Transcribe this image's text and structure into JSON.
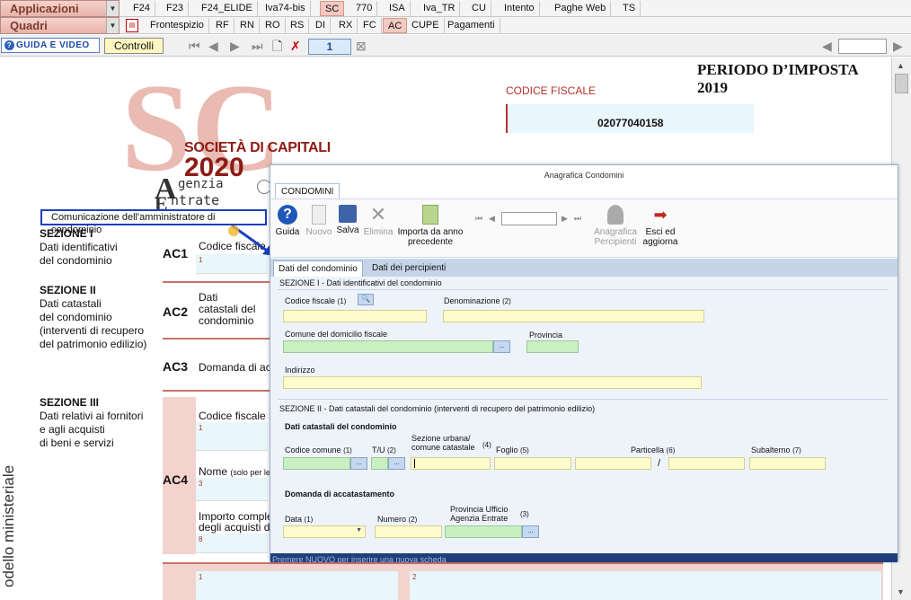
{
  "menu": {
    "applicazioni": "Applicazioni",
    "quadri": "Quadri"
  },
  "tabs_top": [
    "F24",
    "F23",
    "F24_ELIDE",
    "Iva74-bis",
    "SC",
    "770",
    "ISA",
    "Iva_TR",
    "CU",
    "Intento",
    "Paghe Web",
    "TS"
  ],
  "tabs_quadri": [
    "Frontespizio",
    "RF",
    "RN",
    "RO",
    "RS",
    "DI",
    "RX",
    "FC",
    "AC",
    "CUPE",
    "Pagamenti"
  ],
  "toolbar": {
    "guida": "GUIDA E VIDEO",
    "controlli": "Controlli",
    "page": "1"
  },
  "doc": {
    "periodo": "PERIODO D’IMPOSTA 2019",
    "codice_fiscale_label": "CODICE FISCALE",
    "codice_fiscale": "02077040158",
    "logo_line1": "SOCIETÀ DI CAPITALI",
    "logo_year": "2020",
    "logo_agenzia": "genzia",
    "logo_entrate": "ntrate",
    "tooltip": "Comunicazione dell'amministratore di condominio",
    "sez1_title": "SEZIONE I",
    "sez1_text": [
      "Dati identificativi",
      "del condominio"
    ],
    "sez2_title": "SEZIONE II",
    "sez2_text": [
      "Dati catastali",
      "del condominio",
      "(interventi di recupero",
      "del patrimonio edilizio)"
    ],
    "sez3_title": "SEZIONE III",
    "sez3_text": [
      "Dati relativi ai fornitori",
      "e agli acquisti",
      "di beni e servizi"
    ],
    "ac1": "AC1",
    "ac2": "AC2",
    "ac3": "AC3",
    "ac4": "AC4",
    "ac1_label": "Codice fiscale",
    "ac2_label": [
      "Dati",
      "catastali del",
      "condominio"
    ],
    "ac3_label": "Domanda di ac",
    "ac4_cf": "Codice fiscale",
    "ac4_nome": "Nome",
    "ac4_nome_note": "(solo per le",
    "ac4_importo": [
      "Importo comple",
      "degli acquisti di"
    ],
    "n1": "1",
    "n3": "3",
    "n8": "8",
    "n2": "2",
    "vertical": "odello ministeriale"
  },
  "dialog": {
    "title": "Anagrafica Condomini",
    "tab": "CONDOMINI",
    "buttons": {
      "guida": "Guida",
      "nuovo": "Nuovo",
      "salva": "Salva",
      "elimina": "Elimina",
      "importa": [
        "Importa da anno",
        "precedente"
      ],
      "anag": [
        "Anagrafica",
        "Percipienti"
      ],
      "esci": [
        "Esci ed",
        "aggiorna"
      ]
    },
    "subtabs": [
      "Dati del condominio",
      "Dati dei percipienti"
    ],
    "s1_title": "SEZIONE I - Dati identificativi del condominio",
    "cf": "Codice fiscale",
    "cf_n": "(1)",
    "den": "Denominazione",
    "den_n": "(2)",
    "comune": "Comune del domicilio fiscale",
    "provincia": "Provincia",
    "indirizzo": "Indirizzo",
    "s2_title": "SEZIONE II - Dati catastali del condominio (interventi di recupero del patrimonio edilizio)",
    "dati_cat": "Dati catastali del condominio",
    "cod_comune": "Codice comune",
    "cod_comune_n": "(1)",
    "tu": "T/U",
    "tu_n": "(2)",
    "sez_urb": [
      "Sezione urbana/",
      "comune catastale"
    ],
    "sez_urb_n": "(4)",
    "foglio": "Foglio",
    "foglio_n": "(5)",
    "particella": "Particella",
    "particella_n": "(6)",
    "subalterno": "Subalterno",
    "subalterno_n": "(7)",
    "slash": "/",
    "dom_acc": "Domanda di accatastamento",
    "data": "Data",
    "data_n": "(1)",
    "numero": "Numero",
    "numero_n": "(2)",
    "prov_uff": [
      "Provincia Ufficio",
      "Agenzia Entrate"
    ],
    "prov_uff_n": "(3)",
    "btn_dots": "...",
    "status": "Premere NUOVO per inserire una nuova scheda"
  }
}
